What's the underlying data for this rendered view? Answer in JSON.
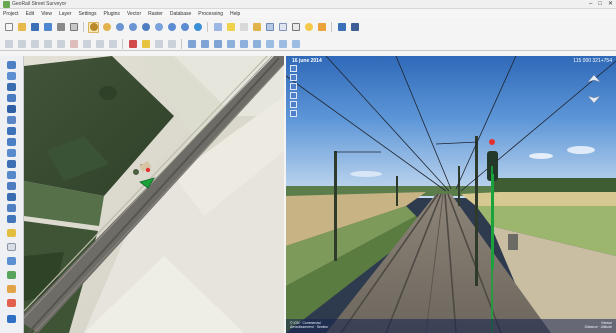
{
  "window": {
    "title": "GeoRail Street Surveyor",
    "controls": [
      "–",
      "□",
      "✕"
    ]
  },
  "menu": [
    "Project",
    "Edit",
    "View",
    "Layer",
    "Settings",
    "Plugins",
    "Vector",
    "Raster",
    "Database",
    "Processing",
    "Help"
  ],
  "street_view": {
    "date": "16 june 2014",
    "chainage": "115 000 321+754",
    "footer_left": [
      "© IGN",
      "Commercial",
      "Arrondissement",
      "Secteur"
    ],
    "footer_right": [
      "Vitesse",
      "Distance",
      "Altitude"
    ]
  },
  "colors": {
    "accent": "#2b6cc4",
    "marker": "#1aa33a",
    "pin": "#e53030"
  },
  "icons": {
    "toolbar1": [
      "new-project-icon",
      "open-icon",
      "save-icon",
      "save-as-icon",
      "print-icon",
      "compose-icon",
      "pan-icon",
      "pan-selection-icon",
      "zoom-in-icon",
      "zoom-out-icon",
      "zoom-full-icon",
      "zoom-layer-icon",
      "zoom-last-icon",
      "zoom-next-icon",
      "refresh-icon",
      "identify-icon",
      "select-icon",
      "deselect-icon",
      "measure-icon",
      "layer-table-icon",
      "add-layer-icon",
      "label-icon",
      "annotation-icon",
      "tips-icon",
      "help-icon"
    ],
    "toolbar2": [
      "edit-pencil-icon",
      "save-edits-icon",
      "add-feature-icon",
      "move-feature-icon",
      "node-tool-icon",
      "delete-icon",
      "cut-icon",
      "copy-icon",
      "paste-icon",
      "undo-icon",
      "redo-icon",
      "digitize-icon",
      "simplify-icon",
      "add-ring-icon",
      "add-part-icon",
      "fill-ring-icon",
      "delete-ring-icon",
      "reshape-icon",
      "offset-icon",
      "split-icon",
      "merge-icon",
      "rotate-icon"
    ],
    "tools": [
      "add-vector-layer-icon",
      "add-raster-layer-icon",
      "add-postgis-icon",
      "add-spatialite-icon",
      "add-wms-icon",
      "add-wcs-icon",
      "add-wfs-icon",
      "add-delimited-icon",
      "new-layer-icon",
      "new-spatialite-icon",
      "new-temp-layer-icon",
      "add-virtual-icon",
      "add-oracle-icon",
      "add-mssql-icon",
      "add-db2-icon",
      "add-arcgis-icon",
      "add-wfs2-icon",
      "add-gpx-icon",
      "add-grass-icon",
      "add-csv-icon",
      "settings-icon",
      "layer-style-icon"
    ]
  }
}
